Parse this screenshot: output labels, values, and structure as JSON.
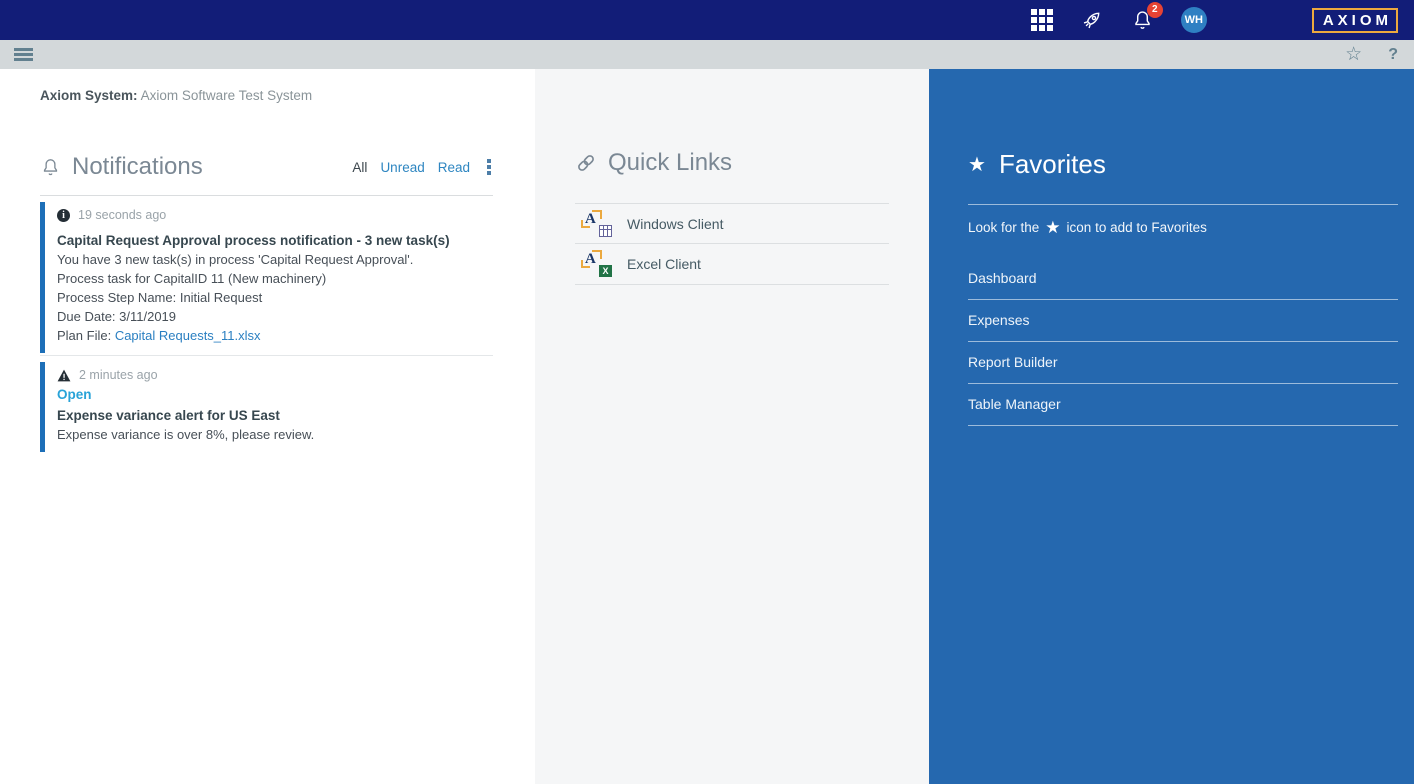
{
  "top_nav": {
    "logo": "AXIOM",
    "avatar_initials": "WH",
    "notification_count": "2"
  },
  "toolbar": {
    "help_label": "?"
  },
  "system_bar": {
    "label": "Axiom System:",
    "value": "Axiom Software Test System"
  },
  "notifications": {
    "title": "Notifications",
    "filters": {
      "all": "All",
      "unread": "Unread",
      "read": "Read"
    },
    "items": [
      {
        "time": "19 seconds ago",
        "icon": "info-icon",
        "title": "Capital Request Approval process notification - 3 new task(s)",
        "lines": [
          "You have 3 new task(s) in process 'Capital Request Approval'.",
          "Process task for CapitalID 11 (New machinery)",
          "Process Step Name: Initial Request",
          "Due Date: 3/11/2019"
        ],
        "plan_file_label": "Plan File: ",
        "plan_file_link": "Capital Requests_11.xlsx"
      },
      {
        "time": "2 minutes ago",
        "icon": "warning-icon",
        "action": "Open",
        "title": "Expense variance alert for US East",
        "lines": [
          "Expense variance is over 8%, please review."
        ]
      }
    ]
  },
  "quick_links": {
    "title": "Quick Links",
    "items": [
      {
        "label": "Windows Client",
        "icon": "axiom-windows-client-icon"
      },
      {
        "label": "Excel Client",
        "icon": "axiom-excel-client-icon",
        "excel_glyph": "X"
      }
    ]
  },
  "favorites": {
    "title": "Favorites",
    "hint_prefix": "Look for the",
    "hint_suffix": "icon to add to Favorites",
    "items": [
      "Dashboard",
      "Expenses",
      "Report Builder",
      "Table Manager"
    ]
  },
  "colors": {
    "top_bar_navy": "#121d78",
    "toolbar_gray": "#d3d8da",
    "favorites_blue": "#2568af",
    "accent_gold": "#eba93f",
    "badge_red": "#e74334",
    "avatar_blue": "#2f80c3",
    "link_blue": "#2e86c1",
    "open_link_blue": "#29a3d8",
    "notification_bar_blue": "#1d6fb8"
  }
}
